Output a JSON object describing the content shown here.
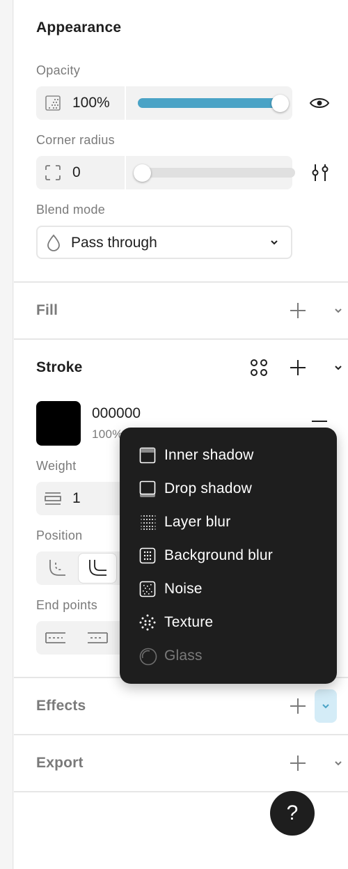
{
  "appearance": {
    "title": "Appearance",
    "opacity_label": "Opacity",
    "opacity_value": "100%",
    "opacity_level": 1.0,
    "corner_radius_label": "Corner radius",
    "corner_radius_value": "0",
    "corner_radius_level": 0.0,
    "blend_mode_label": "Blend mode",
    "blend_mode_value": "Pass through"
  },
  "fill": {
    "title": "Fill"
  },
  "stroke": {
    "title": "Stroke",
    "color_hex": "000000",
    "color_opacity": "100%",
    "weight_label": "Weight",
    "weight_value": "1",
    "position_label": "Position",
    "end_points_label": "End points"
  },
  "effects": {
    "title": "Effects"
  },
  "export": {
    "title": "Export"
  },
  "effects_menu": {
    "items": [
      {
        "label": "Inner shadow",
        "icon": "inner-shadow-icon",
        "enabled": true
      },
      {
        "label": "Drop shadow",
        "icon": "drop-shadow-icon",
        "enabled": true
      },
      {
        "label": "Layer blur",
        "icon": "layer-blur-icon",
        "enabled": true
      },
      {
        "label": "Background blur",
        "icon": "background-blur-icon",
        "enabled": true
      },
      {
        "label": "Noise",
        "icon": "noise-icon",
        "enabled": true
      },
      {
        "label": "Texture",
        "icon": "texture-icon",
        "enabled": true
      },
      {
        "label": "Glass",
        "icon": "glass-icon",
        "enabled": false
      }
    ]
  },
  "help": {
    "label": "?"
  },
  "colors": {
    "accent": "#4aa3c6",
    "panel": "#ffffff",
    "field": "#f2f2f2",
    "menu": "#1e1e1e",
    "stroke_swatch": "#000000",
    "effects_toggle": "#d4ecf7"
  }
}
